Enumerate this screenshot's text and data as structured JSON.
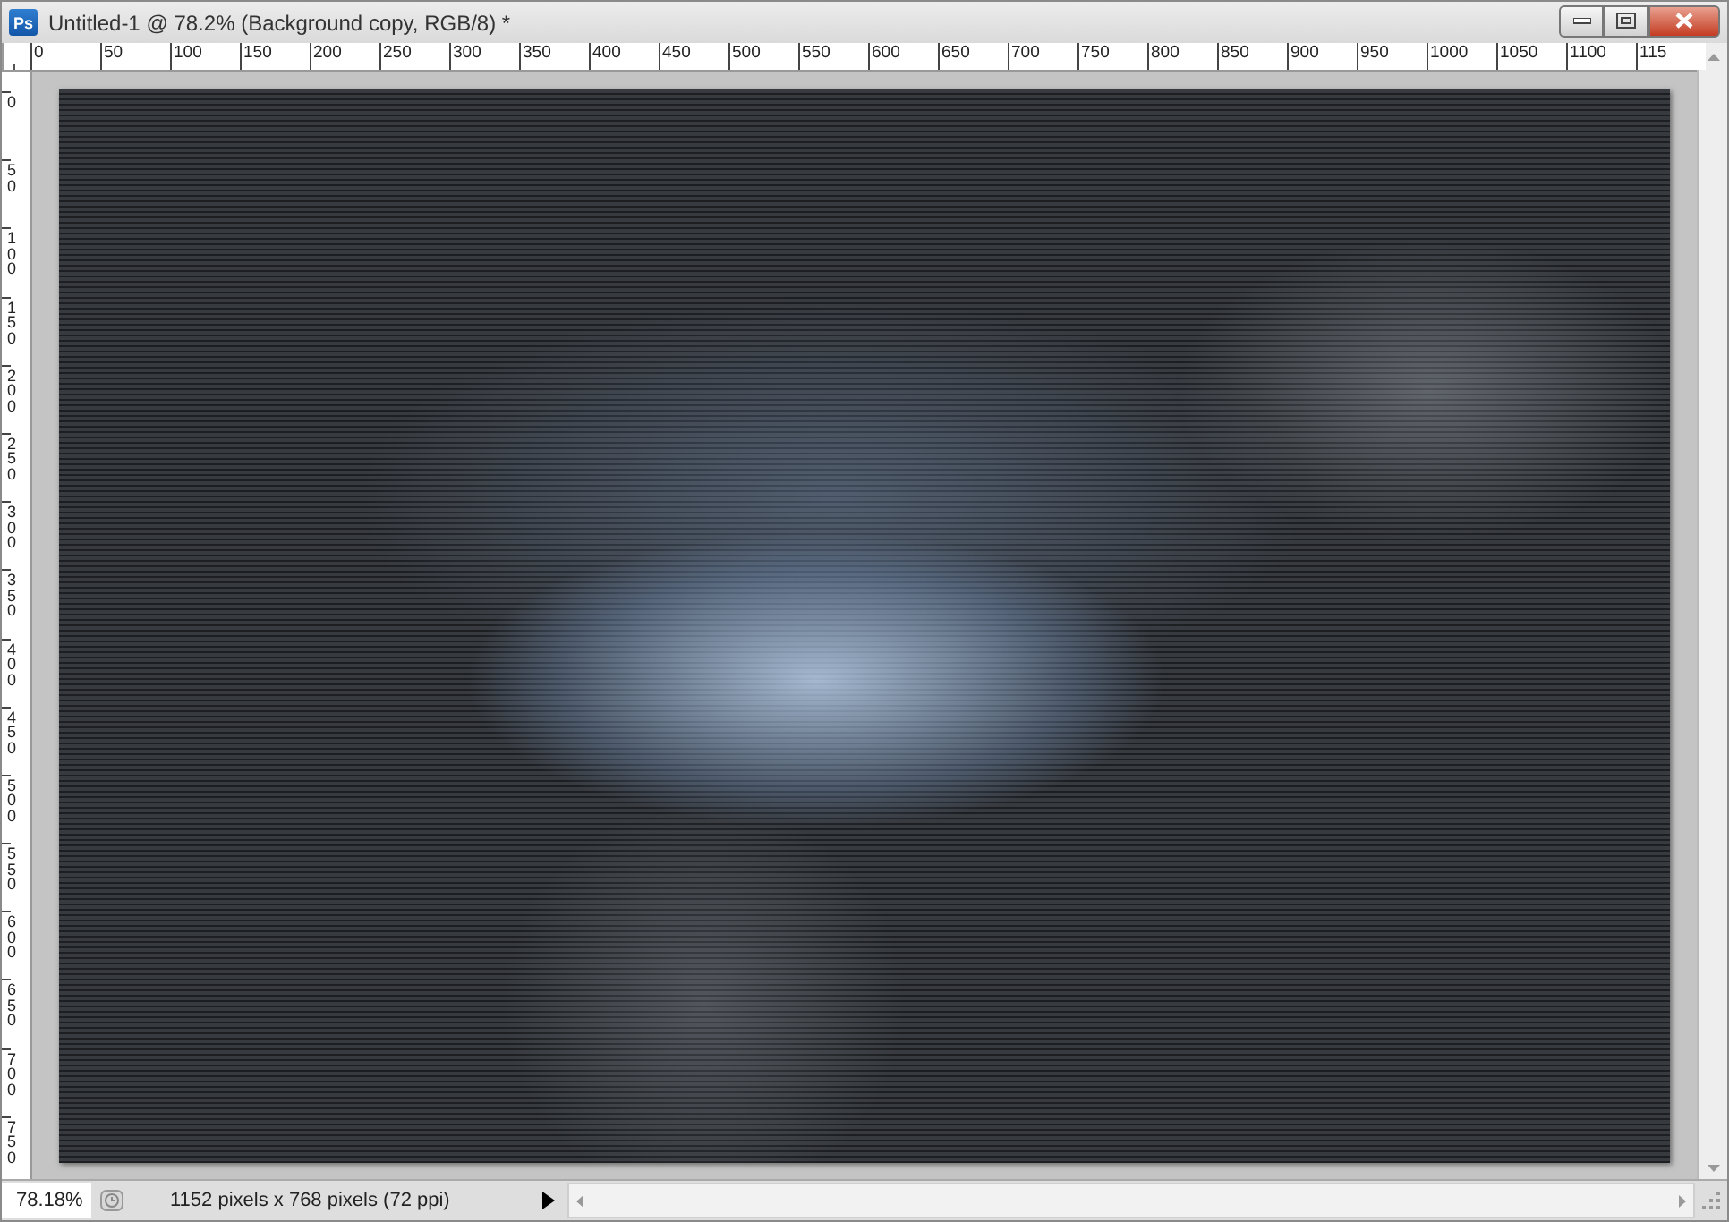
{
  "window": {
    "app_icon": "Ps",
    "title": "Untitled-1 @ 78.2% (Background copy, RGB/8) *"
  },
  "ruler_horizontal": [
    "0",
    "50",
    "100",
    "150",
    "200",
    "250",
    "300",
    "350",
    "400",
    "450",
    "500",
    "550",
    "600",
    "650",
    "700",
    "750",
    "800",
    "850",
    "900",
    "950",
    "1000",
    "1050",
    "1100",
    "115"
  ],
  "ruler_vertical": [
    "0",
    "50",
    "100",
    "150",
    "200",
    "250",
    "300",
    "350",
    "400",
    "450",
    "500",
    "550",
    "600",
    "650",
    "700",
    "750"
  ],
  "status_bar": {
    "zoom": "78.18%",
    "document_info": "1152 pixels x 768 pixels (72 ppi)"
  }
}
